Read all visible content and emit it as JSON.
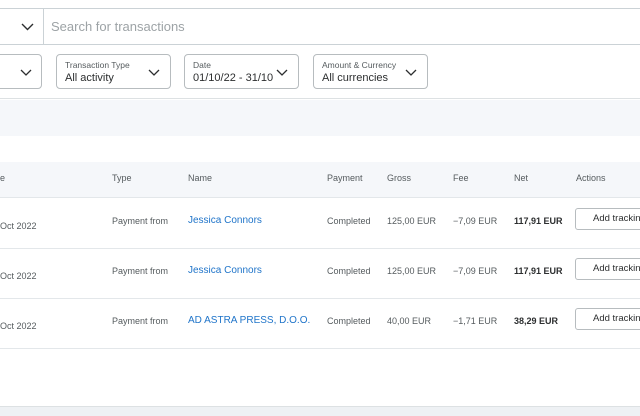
{
  "search": {
    "placeholder": "Search for transactions"
  },
  "filters": [
    {
      "label": "",
      "value": ""
    },
    {
      "label": "Transaction Type",
      "value": "All activity"
    },
    {
      "label": "Date",
      "value": "01/10/22 - 31/10"
    },
    {
      "label": "Amount & Currency",
      "value": "All currencies"
    }
  ],
  "table": {
    "headers": {
      "date": "e",
      "type": "Type",
      "name": "Name",
      "payment": "Payment",
      "gross": "Gross",
      "fee": "Fee",
      "net": "Net",
      "actions": "Actions"
    },
    "rows": [
      {
        "date": "Oct 2022",
        "type": "Payment from",
        "name": "Jessica Connors",
        "payment": "Completed",
        "gross": "125,00 EUR",
        "fee": "−7,09 EUR",
        "net": "117,91 EUR",
        "action": "Add tracking"
      },
      {
        "date": "Oct 2022",
        "type": "Payment from",
        "name": "Jessica Connors",
        "payment": "Completed",
        "gross": "125,00 EUR",
        "fee": "−7,09 EUR",
        "net": "117,91 EUR",
        "action": "Add tracking"
      },
      {
        "date": "Oct 2022",
        "type": "Payment from",
        "name": "AD ASTRA PRESS, D.O.O.",
        "payment": "Completed",
        "gross": "40,00 EUR",
        "fee": "−1,71 EUR",
        "net": "38,29 EUR",
        "action": "Add tracking"
      }
    ]
  },
  "icons": {
    "chevron": "chevron-down-icon"
  },
  "colors": {
    "link": "#1f74c9",
    "border": "#b7bcbf",
    "band": "#f5f7fa"
  }
}
